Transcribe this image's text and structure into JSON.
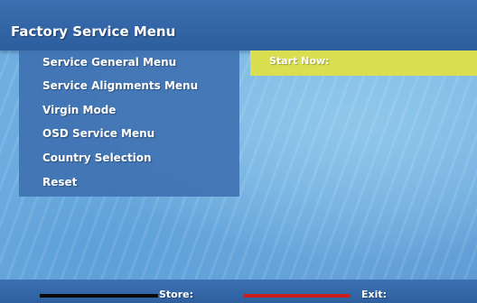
{
  "header": {
    "title": "Factory Service Menu"
  },
  "menu": {
    "items": [
      {
        "label": "Service General Menu"
      },
      {
        "label": "Service Alignments Menu"
      },
      {
        "label": "Virgin Mode"
      },
      {
        "label": "OSD Service Menu"
      },
      {
        "label": "Country Selection"
      },
      {
        "label": "Reset"
      }
    ]
  },
  "status": {
    "label": "Start Now:",
    "color": "#d9df50"
  },
  "footer": {
    "store_label": "Store:",
    "exit_label": "Exit:",
    "store_color": "#0a0a0a",
    "exit_color": "#c8201e"
  }
}
